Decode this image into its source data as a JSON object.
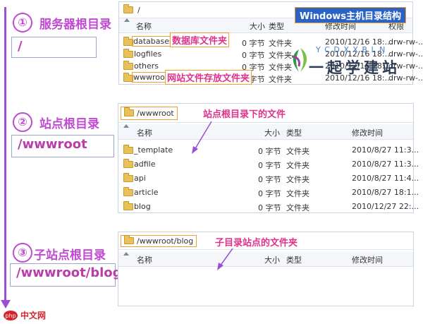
{
  "steps": [
    {
      "num": "①",
      "title": "服务器根目录",
      "path": "/"
    },
    {
      "num": "②",
      "title": "站点根目录",
      "path": "/wwwroot"
    },
    {
      "num": "③",
      "title": "子站点根目录",
      "path": "/wwwroot/blog"
    }
  ],
  "panel1": {
    "path": "/",
    "columns": [
      "名称",
      "大小",
      "类型",
      "修改时间",
      "权限"
    ],
    "rows": [
      {
        "name": "databases",
        "size": "0 字节",
        "type": "文件夹",
        "date": "2010/12/16 18:...",
        "perm": "drw-rw-..."
      },
      {
        "name": "logfiles",
        "size": "0 字节",
        "type": "文件夹",
        "date": "2010/12/16 18:...",
        "perm": "drw-rw-..."
      },
      {
        "name": "others",
        "size": "0 字节",
        "type": "文件夹",
        "date": "2010/12/16 18:...",
        "perm": "drw-rw-..."
      },
      {
        "name": "wwwroot",
        "size": "0 字节",
        "type": "文件夹",
        "date": "2010/12/16 18:...",
        "perm": "drw-rw-..."
      }
    ],
    "annotations": {
      "title": "Windows主机目录结构",
      "databases": "数据库文件夹",
      "wwwroot": "网站文件存放文件夹"
    }
  },
  "panel2": {
    "path": "/wwwroot",
    "columns": [
      "名称",
      "大小",
      "类型",
      "修改时间"
    ],
    "rows": [
      {
        "name": "_template",
        "size": "0 字节",
        "type": "文件夹",
        "date": "2010/8/27 11:3..."
      },
      {
        "name": "adfile",
        "size": "0 字节",
        "type": "文件夹",
        "date": "2010/8/27 11:3..."
      },
      {
        "name": "api",
        "size": "0 字节",
        "type": "文件夹",
        "date": "2010/8/27 11:4..."
      },
      {
        "name": "article",
        "size": "0 字节",
        "type": "文件夹",
        "date": "2010/8/27 18:1..."
      },
      {
        "name": "blog",
        "size": "0 字节",
        "type": "文件夹",
        "date": "2010/12/27 22:..."
      }
    ],
    "annotation": "站点根目录下的文件"
  },
  "panel3": {
    "path": "/wwwroot/blog",
    "columns": [
      "名称",
      "大小",
      "类型",
      "修改时间"
    ],
    "annotation": "子目录站点的文件夹"
  },
  "watermark": {
    "letters": "Y C D X X B L N",
    "chinese": "一起学建站"
  },
  "footer_logo": "中文网",
  "colors": {
    "accent": "#c04ad2",
    "annotation": "#e0328a",
    "highlight_border": "#f0a030",
    "timeline": "#9a4fd6"
  }
}
